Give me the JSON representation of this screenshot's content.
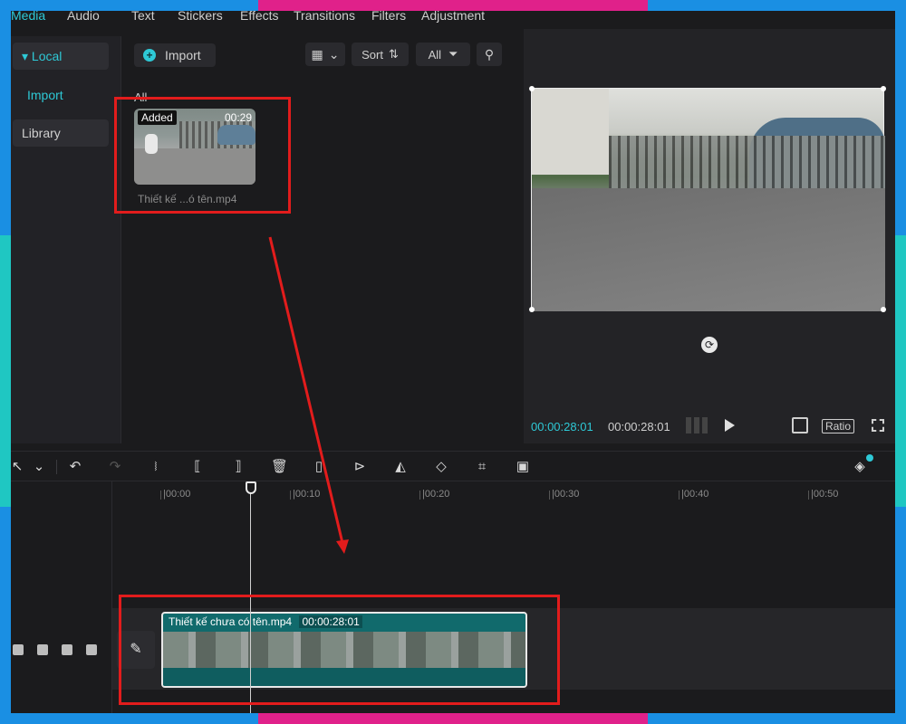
{
  "topnav": [
    "Media",
    "Audio",
    "Text",
    "Stickers",
    "Effects",
    "Transitions",
    "Filters",
    "Adjustment"
  ],
  "sidebar": {
    "local": "Local",
    "import": "Import",
    "library": "Library"
  },
  "media": {
    "import_label": "Import",
    "sort_label": "Sort",
    "all_filter_label": "All",
    "section_label": "All",
    "item": {
      "tag": "Added",
      "duration": "00:29",
      "name": "Thiết kế ...ó tên.mp4"
    }
  },
  "preview": {
    "current_time": "00:00:28:01",
    "total_time": "00:00:28:01",
    "ratio_label": "Ratio"
  },
  "ruler": [
    "|00:00",
    "|00:10",
    "|00:20",
    "|00:30",
    "|00:40",
    "|00:50"
  ],
  "clip": {
    "name": "Thiết kế chưa có tên.mp4",
    "duration": "00:00:28:01"
  },
  "colors": {
    "accent": "#2ec9d6",
    "annotation": "#e21c1c",
    "frame_blue": "#1a8fe3",
    "frame_pink": "#e0218a",
    "frame_teal": "#1fc7c2"
  }
}
